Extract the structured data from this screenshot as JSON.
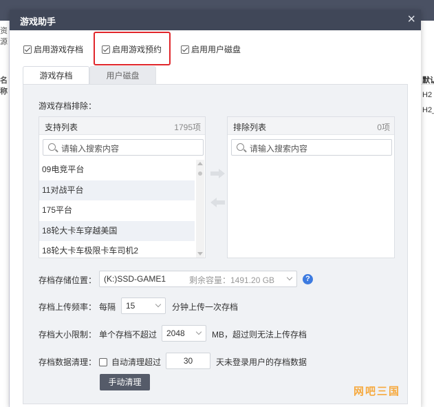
{
  "background": {
    "left_fragments": [
      "资源",
      "名称"
    ],
    "right_fragments": [
      "默认",
      "H2",
      "H2_"
    ]
  },
  "dialog": {
    "title": "游戏助手",
    "close_symbol": "×"
  },
  "options": {
    "enable_save": {
      "label": "启用游戏存档",
      "checked": true
    },
    "enable_reservation": {
      "label": "启用游戏预约",
      "checked": true
    },
    "enable_disk": {
      "label": "启用用户磁盘",
      "checked": true
    }
  },
  "tabs": [
    {
      "label": "游戏存档",
      "active": true
    },
    {
      "label": "用户磁盘",
      "active": false
    }
  ],
  "exclusion": {
    "section_label": "游戏存档排除：",
    "support_list": {
      "title": "支持列表",
      "count": "1795项",
      "search_placeholder": "请输入搜索内容",
      "items": [
        "09电竞平台",
        "11对战平台",
        "175平台",
        "18轮大卡车穿越美国",
        "18轮大卡车极限卡车司机2"
      ]
    },
    "exclude_list": {
      "title": "排除列表",
      "count": "0项",
      "search_placeholder": "请输入搜索内容",
      "items": []
    }
  },
  "settings": {
    "location": {
      "label": "存档存储位置：",
      "value": "(K:)SSD-GAME1",
      "capacity": "剩余容量：1491.20 GB",
      "help": "?"
    },
    "frequency": {
      "label": "存档上传频率：",
      "prefix": "每隔",
      "value": "15",
      "suffix": "分钟上传一次存档"
    },
    "size_limit": {
      "label": "存档大小限制：",
      "prefix": "单个存档不超过",
      "value": "2048",
      "suffix": "MB，超过则无法上传存档"
    },
    "cleanup": {
      "label": "存档数据清理：",
      "auto_label": "自动清理超过",
      "auto_checked": false,
      "days": "30",
      "suffix": "天未登录用户的存档数据",
      "manual_button": "手动清理"
    }
  },
  "watermark": "网吧三国"
}
